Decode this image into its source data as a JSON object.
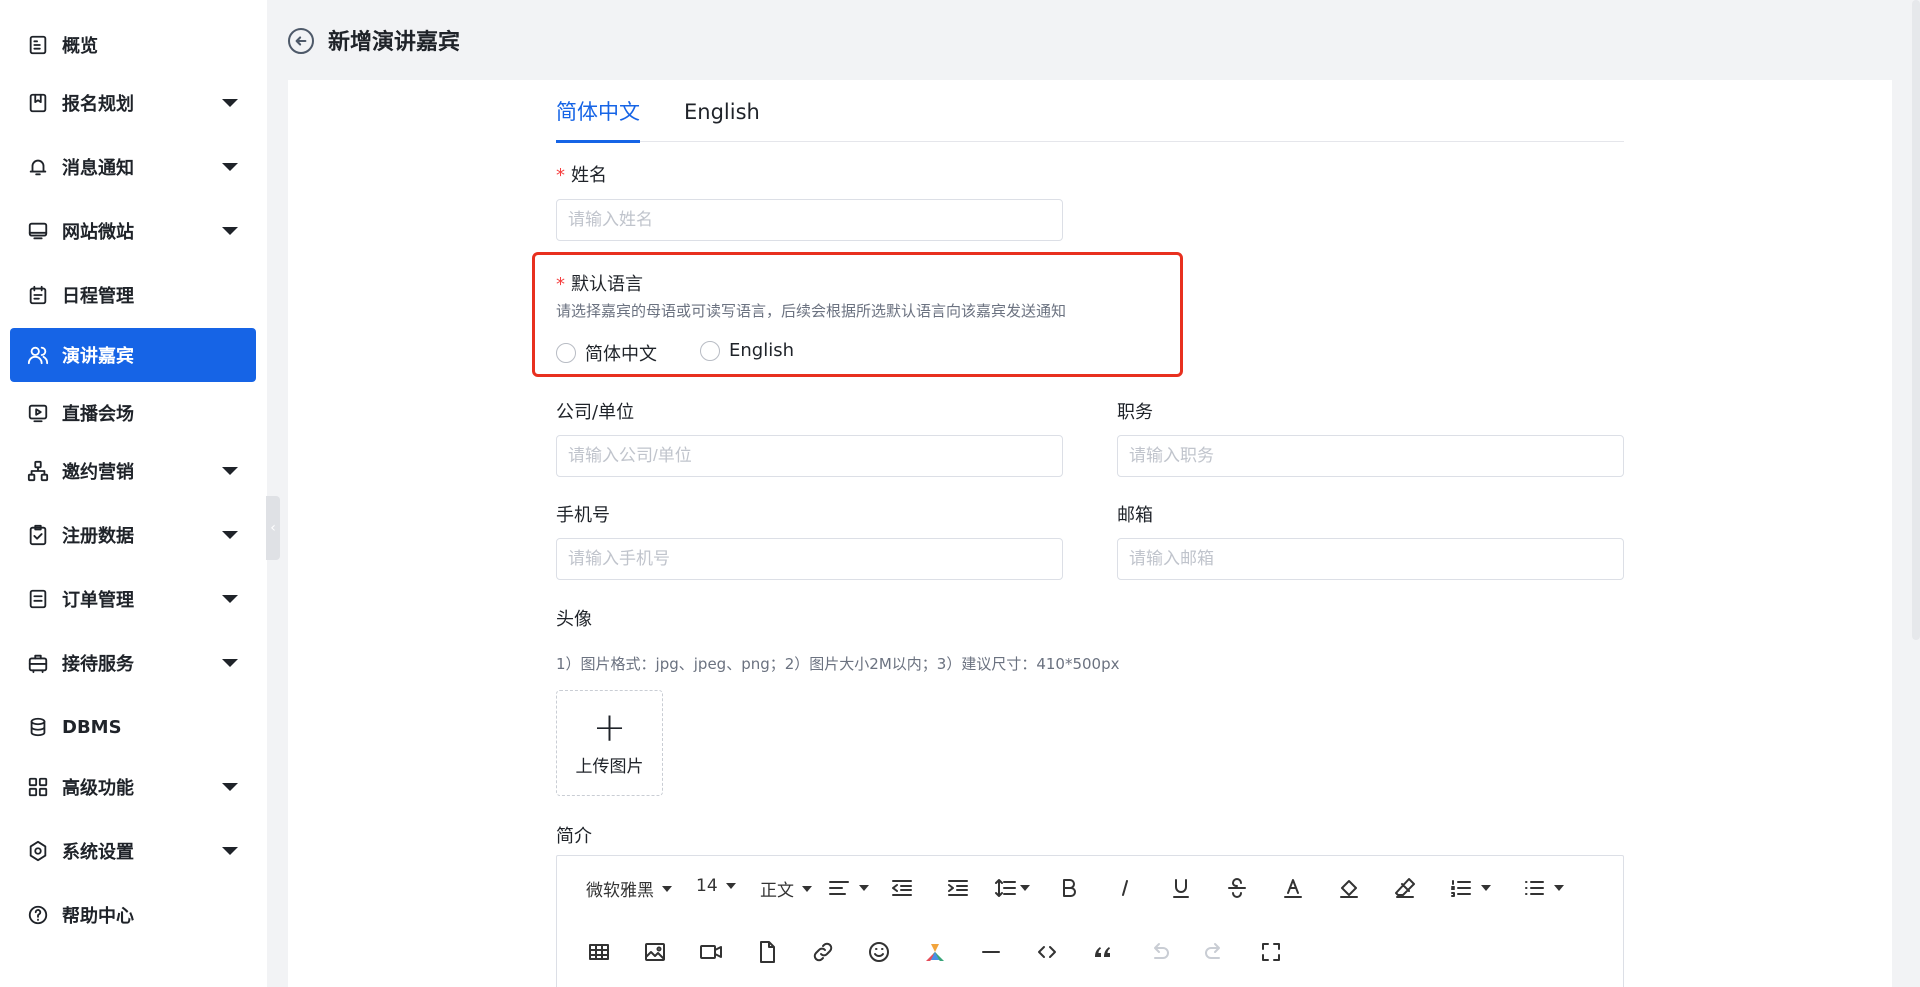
{
  "sidebar": {
    "items": [
      {
        "label": "概览",
        "icon": "overview-icon",
        "expandable": false
      },
      {
        "label": "报名规划",
        "icon": "bookmark-icon",
        "expandable": true
      },
      {
        "label": "消息通知",
        "icon": "bell-icon",
        "expandable": true
      },
      {
        "label": "网站微站",
        "icon": "monitor-icon",
        "expandable": true
      },
      {
        "label": "日程管理",
        "icon": "calendar-icon",
        "expandable": false
      },
      {
        "label": "演讲嘉宾",
        "icon": "users-icon",
        "expandable": false,
        "active": true
      },
      {
        "label": "直播会场",
        "icon": "live-icon",
        "expandable": false
      },
      {
        "label": "邀约营销",
        "icon": "network-icon",
        "expandable": true
      },
      {
        "label": "注册数据",
        "icon": "clipboard-check-icon",
        "expandable": true
      },
      {
        "label": "订单管理",
        "icon": "order-icon",
        "expandable": true
      },
      {
        "label": "接待服务",
        "icon": "briefcase-icon",
        "expandable": true
      },
      {
        "label": "DBMS",
        "icon": "database-icon",
        "expandable": false
      },
      {
        "label": "高级功能",
        "icon": "grid-icon",
        "expandable": true
      },
      {
        "label": "系统设置",
        "icon": "settings-icon",
        "expandable": true
      },
      {
        "label": "帮助中心",
        "icon": "help-icon",
        "expandable": false
      }
    ]
  },
  "header": {
    "title": "新增演讲嘉宾"
  },
  "tabs": [
    {
      "label": "简体中文",
      "active": true
    },
    {
      "label": "English",
      "active": false
    }
  ],
  "form": {
    "name": {
      "label": "姓名",
      "placeholder": "请输入姓名",
      "value": ""
    },
    "default_language": {
      "label": "默认语言",
      "hint": "请选择嘉宾的母语或可读写语言，后续会根据所选默认语言向该嘉宾发送通知",
      "options": [
        "简体中文",
        "English"
      ]
    },
    "company": {
      "label": "公司/单位",
      "placeholder": "请输入公司/单位",
      "value": ""
    },
    "position": {
      "label": "职务",
      "placeholder": "请输入职务",
      "value": ""
    },
    "phone": {
      "label": "手机号",
      "placeholder": "请输入手机号",
      "value": ""
    },
    "email": {
      "label": "邮箱",
      "placeholder": "请输入邮箱",
      "value": ""
    },
    "avatar": {
      "label": "头像",
      "hint": "1）图片格式：jpg、jpeg、png；2）图片大小2M以内；3）建议尺寸：410*500px",
      "upload_label": "上传图片"
    },
    "intro": {
      "label": "简介"
    }
  },
  "editor_toolbar": {
    "font_family": "微软雅黑",
    "font_size": "14",
    "paragraph": "正文"
  },
  "colors": {
    "primary": "#1664e6",
    "required": "#f53f3f",
    "highlight": "#e8301f"
  }
}
